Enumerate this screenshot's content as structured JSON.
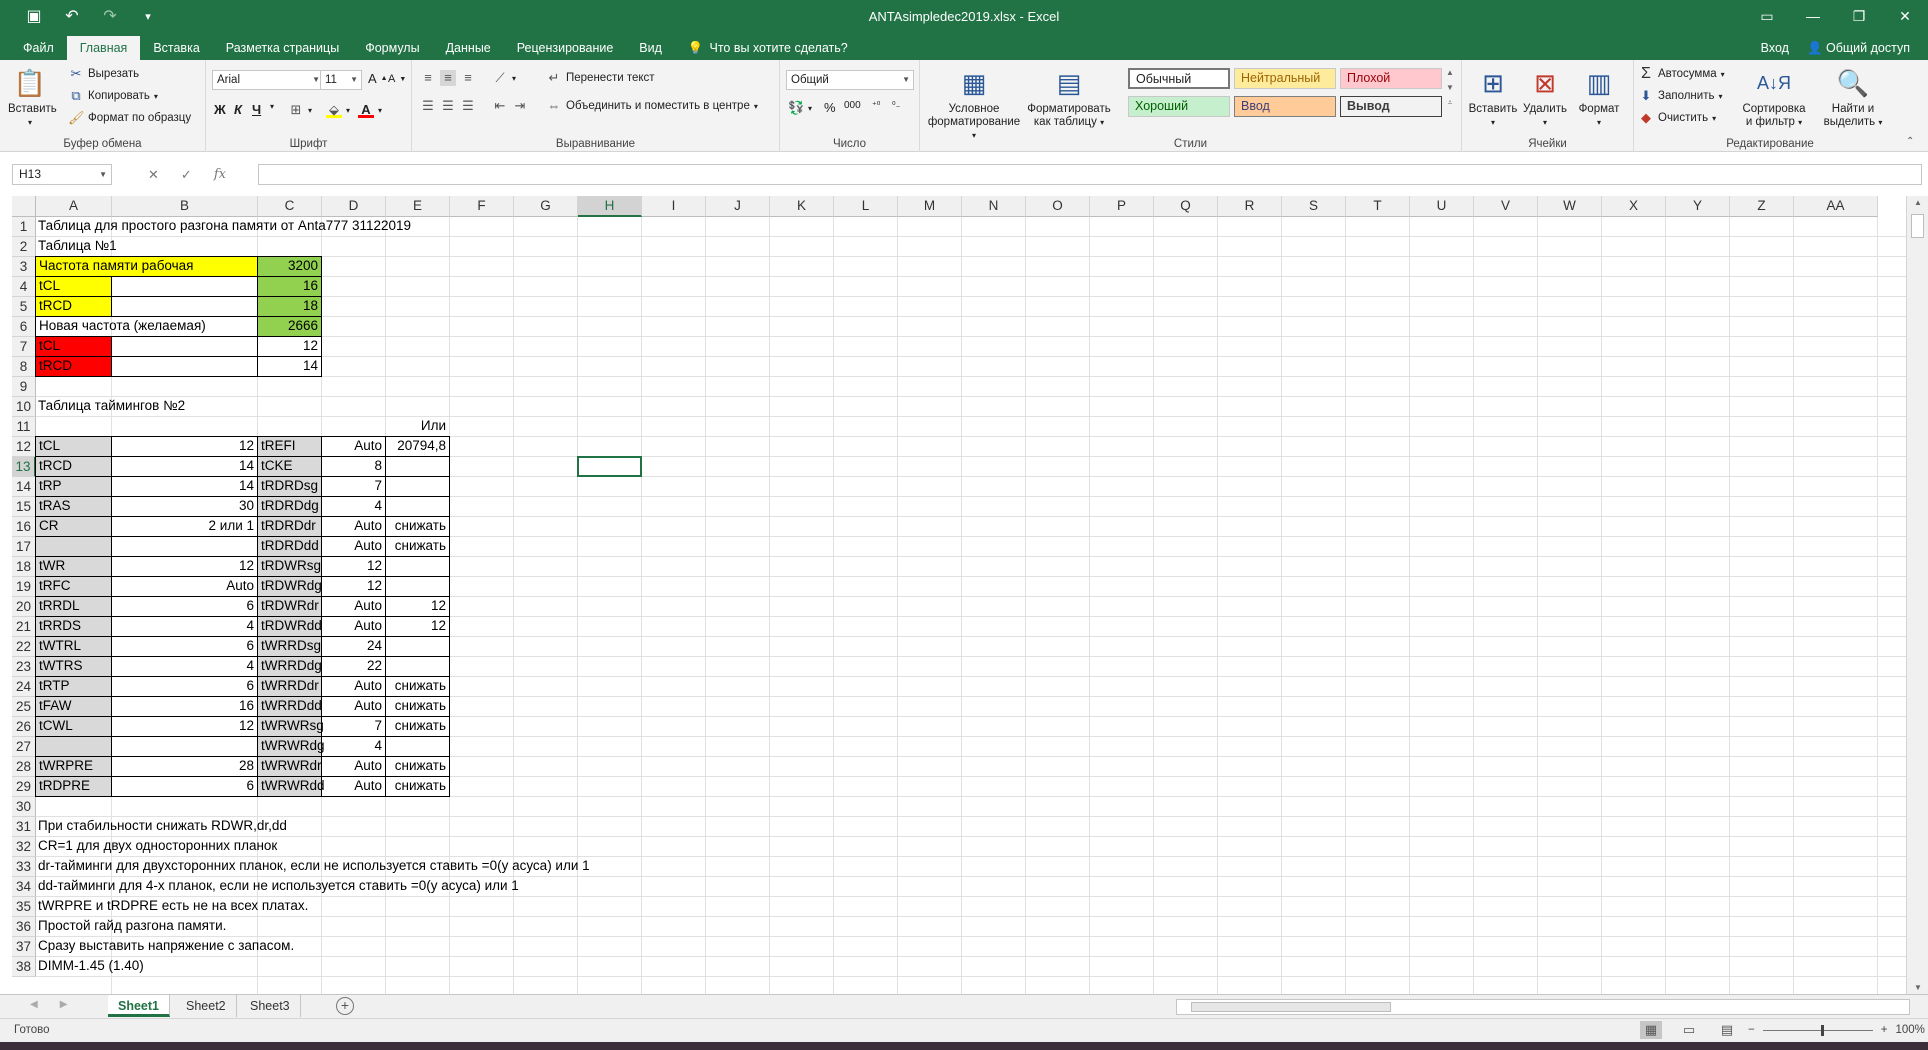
{
  "window": {
    "title": "ANTAsimpledec2019.xlsx - Excel",
    "qat": [
      "save-icon",
      "undo-icon",
      "redo-icon",
      "customize-icon"
    ]
  },
  "tabs": [
    "Файл",
    "Главная",
    "Вставка",
    "Разметка страницы",
    "Формулы",
    "Данные",
    "Рецензирование",
    "Вид"
  ],
  "active_tab": "Главная",
  "tell_me": "Что вы хотите сделать?",
  "signin": "Вход",
  "share": "Общий доступ",
  "ribbon": {
    "clipboard": {
      "paste": "Вставить",
      "cut": "Вырезать",
      "copy": "Копировать",
      "format_painter": "Формат по образцу",
      "label": "Буфер обмена"
    },
    "font": {
      "name": "Arial",
      "size": "11",
      "bold": "Ж",
      "italic": "К",
      "underline": "Ч",
      "label": "Шрифт"
    },
    "alignment": {
      "wrap": "Перенести текст",
      "merge": "Объединить и поместить в центре",
      "label": "Выравнивание"
    },
    "number": {
      "format": "Общий",
      "percent": "%",
      "thousands": "000",
      "label": "Число"
    },
    "styles": {
      "conditional": [
        "Условное",
        "форматирование"
      ],
      "as_table": [
        "Форматировать",
        "как таблицу"
      ],
      "normal": "Обычный",
      "neutral": "Нейтральный",
      "bad": "Плохой",
      "good": "Хороший",
      "input": "Ввод",
      "output": "Вывод",
      "label": "Стили"
    },
    "cells": {
      "insert": "Вставить",
      "delete": "Удалить",
      "format": "Формат",
      "label": "Ячейки"
    },
    "editing": {
      "autosum": "Автосумма",
      "fill": "Заполнить",
      "clear": "Очистить",
      "sort": [
        "Сортировка",
        "и фильтр"
      ],
      "find": [
        "Найти и",
        "выделить"
      ],
      "label": "Редактирование"
    }
  },
  "formula_bar": {
    "name_box": "H13",
    "cancel": "✕",
    "enter": "✓",
    "fx": "fx",
    "value": ""
  },
  "columns": [
    "A",
    "B",
    "C",
    "D",
    "E",
    "F",
    "G",
    "H",
    "I",
    "J",
    "K",
    "L",
    "M",
    "N",
    "O",
    "P",
    "Q",
    "R",
    "S",
    "T",
    "U",
    "V",
    "W",
    "X",
    "Y",
    "Z",
    "AA"
  ],
  "rows": [
    "1",
    "2",
    "3",
    "4",
    "5",
    "6",
    "7",
    "8",
    "9",
    "10",
    "11",
    "12",
    "13",
    "14",
    "15",
    "16",
    "17",
    "18",
    "19",
    "20",
    "21",
    "22",
    "23",
    "24",
    "25",
    "26",
    "27",
    "28",
    "29",
    "30",
    "31",
    "32",
    "33",
    "34",
    "35",
    "36",
    "37",
    "38"
  ],
  "selected_cell": {
    "col": "H",
    "row": "13"
  },
  "cells": [
    {
      "row": 1,
      "col": "A",
      "v": "Таблица для простого разгона памяти от  Anta777 31122019"
    },
    {
      "row": 2,
      "col": "A",
      "v": "Таблица №1"
    },
    {
      "row": 3,
      "col": "A",
      "v": "Частота памяти рабочая",
      "fill": "yel",
      "span": 3,
      "border": true
    },
    {
      "row": 3,
      "col": "C",
      "v": "3200",
      "fill": "grn",
      "align": "r",
      "border": true
    },
    {
      "row": 4,
      "col": "A",
      "v": "tCL",
      "fill": "yel",
      "border": true
    },
    {
      "row": 4,
      "col": "B",
      "v": "",
      "border": true
    },
    {
      "row": 4,
      "col": "C",
      "v": "16",
      "fill": "grn",
      "align": "r",
      "border": true
    },
    {
      "row": 5,
      "col": "A",
      "v": "tRCD",
      "fill": "yel",
      "border": true
    },
    {
      "row": 5,
      "col": "B",
      "v": "",
      "border": true
    },
    {
      "row": 5,
      "col": "C",
      "v": "18",
      "fill": "grn",
      "align": "r",
      "border": true
    },
    {
      "row": 6,
      "col": "A",
      "v": "Новая частота (желаемая)",
      "span": 3,
      "border": true
    },
    {
      "row": 6,
      "col": "C",
      "v": "2666",
      "fill": "grn",
      "align": "r",
      "border": true
    },
    {
      "row": 7,
      "col": "A",
      "v": "tCL",
      "fill": "red",
      "border": true
    },
    {
      "row": 7,
      "col": "B",
      "v": "",
      "border": true
    },
    {
      "row": 7,
      "col": "C",
      "v": "12",
      "align": "r",
      "border": true
    },
    {
      "row": 8,
      "col": "A",
      "v": "tRCD",
      "fill": "red",
      "border": true
    },
    {
      "row": 8,
      "col": "B",
      "v": "",
      "border": true
    },
    {
      "row": 8,
      "col": "C",
      "v": "14",
      "align": "r",
      "border": true
    },
    {
      "row": 10,
      "col": "A",
      "v": "Таблица таймингов №2"
    },
    {
      "row": 11,
      "col": "E",
      "v": "Или",
      "align": "r"
    },
    {
      "row": 12,
      "col": "A",
      "v": "tCL",
      "fill": "gry",
      "border": true
    },
    {
      "row": 12,
      "col": "B",
      "v": "12",
      "align": "r",
      "border": true
    },
    {
      "row": 12,
      "col": "C",
      "v": "tREFI",
      "fill": "gry",
      "border": true
    },
    {
      "row": 12,
      "col": "D",
      "v": "Auto",
      "align": "r",
      "border": true
    },
    {
      "row": 12,
      "col": "E",
      "v": "20794,8",
      "align": "r",
      "border": true
    },
    {
      "row": 13,
      "col": "A",
      "v": "tRCD",
      "fill": "gry",
      "border": true
    },
    {
      "row": 13,
      "col": "B",
      "v": "14",
      "align": "r",
      "border": true
    },
    {
      "row": 13,
      "col": "C",
      "v": "tCKE",
      "fill": "gry",
      "border": true
    },
    {
      "row": 13,
      "col": "D",
      "v": "8",
      "align": "r",
      "border": true
    },
    {
      "row": 13,
      "col": "E",
      "v": "",
      "border": true
    },
    {
      "row": 14,
      "col": "A",
      "v": "tRP",
      "fill": "gry",
      "border": true
    },
    {
      "row": 14,
      "col": "B",
      "v": "14",
      "align": "r",
      "border": true
    },
    {
      "row": 14,
      "col": "C",
      "v": "tRDRDsg",
      "fill": "gry",
      "border": true
    },
    {
      "row": 14,
      "col": "D",
      "v": "7",
      "align": "r",
      "border": true
    },
    {
      "row": 14,
      "col": "E",
      "v": "",
      "border": true
    },
    {
      "row": 15,
      "col": "A",
      "v": "tRAS",
      "fill": "gry",
      "border": true
    },
    {
      "row": 15,
      "col": "B",
      "v": "30",
      "align": "r",
      "border": true
    },
    {
      "row": 15,
      "col": "C",
      "v": "tRDRDdg",
      "fill": "gry",
      "border": true
    },
    {
      "row": 15,
      "col": "D",
      "v": "4",
      "align": "r",
      "border": true
    },
    {
      "row": 15,
      "col": "E",
      "v": "",
      "border": true
    },
    {
      "row": 16,
      "col": "A",
      "v": "CR",
      "fill": "gry",
      "border": true
    },
    {
      "row": 16,
      "col": "B",
      "v": "2 или 1",
      "align": "r",
      "border": true
    },
    {
      "row": 16,
      "col": "C",
      "v": "tRDRDdr",
      "fill": "gry",
      "border": true
    },
    {
      "row": 16,
      "col": "D",
      "v": "Auto",
      "align": "r",
      "border": true
    },
    {
      "row": 16,
      "col": "E",
      "v": "снижать",
      "align": "r",
      "border": true
    },
    {
      "row": 17,
      "col": "A",
      "v": "",
      "fill": "gry",
      "border": true
    },
    {
      "row": 17,
      "col": "B",
      "v": "",
      "border": true
    },
    {
      "row": 17,
      "col": "C",
      "v": "tRDRDdd",
      "fill": "gry",
      "border": true
    },
    {
      "row": 17,
      "col": "D",
      "v": "Auto",
      "align": "r",
      "border": true
    },
    {
      "row": 17,
      "col": "E",
      "v": "снижать",
      "align": "r",
      "border": true
    },
    {
      "row": 18,
      "col": "A",
      "v": "tWR",
      "fill": "gry",
      "border": true
    },
    {
      "row": 18,
      "col": "B",
      "v": "12",
      "align": "r",
      "border": true
    },
    {
      "row": 18,
      "col": "C",
      "v": "tRDWRsg",
      "fill": "gry",
      "border": true
    },
    {
      "row": 18,
      "col": "D",
      "v": "12",
      "align": "r",
      "border": true
    },
    {
      "row": 18,
      "col": "E",
      "v": "",
      "border": true
    },
    {
      "row": 19,
      "col": "A",
      "v": "tRFC",
      "fill": "gry",
      "border": true
    },
    {
      "row": 19,
      "col": "B",
      "v": "Auto",
      "align": "r",
      "border": true
    },
    {
      "row": 19,
      "col": "C",
      "v": "tRDWRdg",
      "fill": "gry",
      "border": true
    },
    {
      "row": 19,
      "col": "D",
      "v": "12",
      "align": "r",
      "border": true
    },
    {
      "row": 19,
      "col": "E",
      "v": "",
      "border": true
    },
    {
      "row": 20,
      "col": "A",
      "v": "tRRDL",
      "fill": "gry",
      "border": true
    },
    {
      "row": 20,
      "col": "B",
      "v": "6",
      "align": "r",
      "border": true
    },
    {
      "row": 20,
      "col": "C",
      "v": "tRDWRdr",
      "fill": "gry",
      "border": true
    },
    {
      "row": 20,
      "col": "D",
      "v": "Auto",
      "align": "r",
      "border": true
    },
    {
      "row": 20,
      "col": "E",
      "v": "12",
      "align": "r",
      "border": true
    },
    {
      "row": 21,
      "col": "A",
      "v": "tRRDS",
      "fill": "gry",
      "border": true
    },
    {
      "row": 21,
      "col": "B",
      "v": "4",
      "align": "r",
      "border": true
    },
    {
      "row": 21,
      "col": "C",
      "v": "tRDWRdd",
      "fill": "gry",
      "border": true
    },
    {
      "row": 21,
      "col": "D",
      "v": "Auto",
      "align": "r",
      "border": true
    },
    {
      "row": 21,
      "col": "E",
      "v": "12",
      "align": "r",
      "border": true
    },
    {
      "row": 22,
      "col": "A",
      "v": "tWTRL",
      "fill": "gry",
      "border": true
    },
    {
      "row": 22,
      "col": "B",
      "v": "6",
      "align": "r",
      "border": true
    },
    {
      "row": 22,
      "col": "C",
      "v": "tWRRDsg",
      "fill": "gry",
      "border": true
    },
    {
      "row": 22,
      "col": "D",
      "v": "24",
      "align": "r",
      "border": true
    },
    {
      "row": 22,
      "col": "E",
      "v": "",
      "border": true
    },
    {
      "row": 23,
      "col": "A",
      "v": "tWTRS",
      "fill": "gry",
      "border": true
    },
    {
      "row": 23,
      "col": "B",
      "v": "4",
      "align": "r",
      "border": true
    },
    {
      "row": 23,
      "col": "C",
      "v": "tWRRDdg",
      "fill": "gry",
      "border": true
    },
    {
      "row": 23,
      "col": "D",
      "v": "22",
      "align": "r",
      "border": true
    },
    {
      "row": 23,
      "col": "E",
      "v": "",
      "border": true
    },
    {
      "row": 24,
      "col": "A",
      "v": "tRTP",
      "fill": "gry",
      "border": true
    },
    {
      "row": 24,
      "col": "B",
      "v": "6",
      "align": "r",
      "border": true
    },
    {
      "row": 24,
      "col": "C",
      "v": "tWRRDdr",
      "fill": "gry",
      "border": true
    },
    {
      "row": 24,
      "col": "D",
      "v": "Auto",
      "align": "r",
      "border": true
    },
    {
      "row": 24,
      "col": "E",
      "v": "снижать",
      "align": "r",
      "border": true
    },
    {
      "row": 25,
      "col": "A",
      "v": "tFAW",
      "fill": "gry",
      "border": true
    },
    {
      "row": 25,
      "col": "B",
      "v": "16",
      "align": "r",
      "border": true
    },
    {
      "row": 25,
      "col": "C",
      "v": "tWRRDdd",
      "fill": "gry",
      "border": true
    },
    {
      "row": 25,
      "col": "D",
      "v": "Auto",
      "align": "r",
      "border": true
    },
    {
      "row": 25,
      "col": "E",
      "v": "снижать",
      "align": "r",
      "border": true
    },
    {
      "row": 26,
      "col": "A",
      "v": "tCWL",
      "fill": "gry",
      "border": true
    },
    {
      "row": 26,
      "col": "B",
      "v": "12",
      "align": "r",
      "border": true
    },
    {
      "row": 26,
      "col": "C",
      "v": "tWRWRsg",
      "fill": "gry",
      "border": true
    },
    {
      "row": 26,
      "col": "D",
      "v": "7",
      "align": "r",
      "border": true
    },
    {
      "row": 26,
      "col": "E",
      "v": "снижать",
      "align": "r",
      "border": true
    },
    {
      "row": 27,
      "col": "A",
      "v": "",
      "fill": "gry",
      "border": true
    },
    {
      "row": 27,
      "col": "B",
      "v": "",
      "border": true
    },
    {
      "row": 27,
      "col": "C",
      "v": "tWRWRdg",
      "fill": "gry",
      "border": true
    },
    {
      "row": 27,
      "col": "D",
      "v": "4",
      "align": "r",
      "border": true
    },
    {
      "row": 27,
      "col": "E",
      "v": "",
      "border": true
    },
    {
      "row": 28,
      "col": "A",
      "v": "tWRPRE",
      "fill": "gry",
      "border": true
    },
    {
      "row": 28,
      "col": "B",
      "v": "28",
      "align": "r",
      "border": true
    },
    {
      "row": 28,
      "col": "C",
      "v": "tWRWRdr",
      "fill": "gry",
      "border": true
    },
    {
      "row": 28,
      "col": "D",
      "v": "Auto",
      "align": "r",
      "border": true
    },
    {
      "row": 28,
      "col": "E",
      "v": "снижать",
      "align": "r",
      "border": true
    },
    {
      "row": 29,
      "col": "A",
      "v": "tRDPRE",
      "fill": "gry",
      "border": true
    },
    {
      "row": 29,
      "col": "B",
      "v": "6",
      "align": "r",
      "border": true
    },
    {
      "row": 29,
      "col": "C",
      "v": "tWRWRdd",
      "fill": "gry",
      "border": true
    },
    {
      "row": 29,
      "col": "D",
      "v": "Auto",
      "align": "r",
      "border": true
    },
    {
      "row": 29,
      "col": "E",
      "v": "снижать",
      "align": "r",
      "border": true
    },
    {
      "row": 31,
      "col": "A",
      "v": "При стабильности снижать RDWR,dr,dd"
    },
    {
      "row": 32,
      "col": "A",
      "v": "CR=1 для двух односторонних планок"
    },
    {
      "row": 33,
      "col": "A",
      "v": "dr-тайминги для двухсторонних планок, если не используется ставить =0(у асуса) или 1"
    },
    {
      "row": 34,
      "col": "A",
      "v": "dd-тайминги для 4-х планок, если не используется ставить =0(у асуса) или 1"
    },
    {
      "row": 35,
      "col": "A",
      "v": "tWRPRE и tRDPRE есть не на всех платах."
    },
    {
      "row": 36,
      "col": "A",
      "v": "Простой гайд разгона памяти."
    },
    {
      "row": 37,
      "col": "A",
      "v": "Сразу выставить напряжение с запасом."
    },
    {
      "row": 38,
      "col": "A",
      "v": "DIMM-1.45 (1.40)"
    }
  ],
  "sheets": [
    "Sheet1",
    "Sheet2",
    "Sheet3"
  ],
  "active_sheet": "Sheet1",
  "status": {
    "ready": "Готово",
    "zoom": "100%"
  },
  "colors": {
    "accent": "#217346",
    "yellow": "#ffff00",
    "green": "#92d050",
    "red": "#ff0000",
    "gray": "#d9d9d9"
  }
}
